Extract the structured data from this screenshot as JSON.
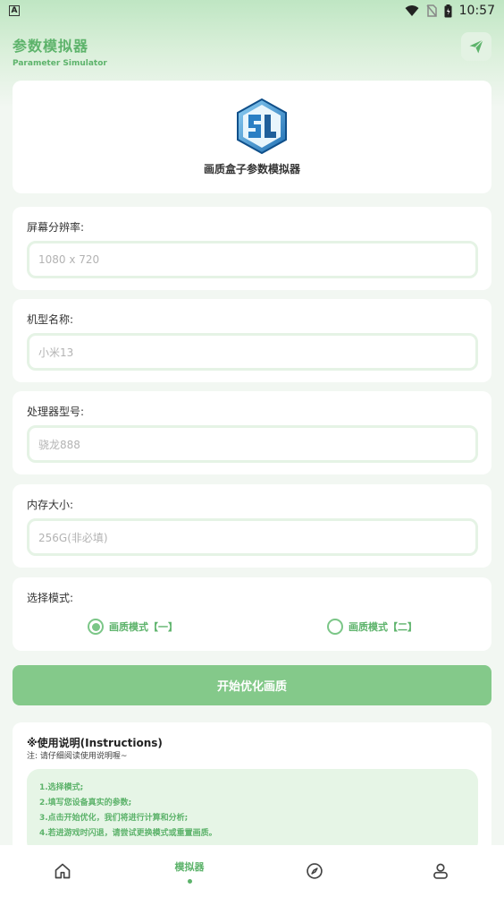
{
  "status_bar": {
    "time": "10:57",
    "app_indicator": "A"
  },
  "header": {
    "title": "参数模拟器",
    "subtitle": "Parameter Simulator",
    "action_icon": "send-icon"
  },
  "logo_card": {
    "title": "画质盒子参数模拟器"
  },
  "fields": [
    {
      "label": "屏幕分辨率:",
      "placeholder": "1080 x 720"
    },
    {
      "label": "机型名称:",
      "placeholder": "小米13"
    },
    {
      "label": "处理器型号:",
      "placeholder": "骁龙888"
    },
    {
      "label": "内存大小:",
      "placeholder": "256G(非必填)"
    }
  ],
  "mode": {
    "label": "选择模式:",
    "options": [
      "画质模式【一】",
      "画质模式【二】"
    ],
    "selected_index": 0
  },
  "start_button": "开始优化画质",
  "instructions": {
    "title": "※使用说明(Instructions)",
    "note": "注: 请仔细阅读使用说明喔~",
    "lines": [
      "1.选择模式;",
      "2.填写您设备真实的参数;",
      "3.点击开始优化，我们将进行计算和分析;",
      "4.若进游戏时闪退，请尝试更换模式或重置画质。"
    ]
  },
  "bottom_nav": {
    "items": [
      {
        "icon": "home-icon",
        "label": ""
      },
      {
        "icon": "",
        "label": "模拟器",
        "active": true
      },
      {
        "icon": "compass-icon",
        "label": ""
      },
      {
        "icon": "profile-icon",
        "label": ""
      }
    ]
  },
  "colors": {
    "accent": "#5db36b",
    "button": "#84c98a",
    "background": "#f2f7f2"
  }
}
